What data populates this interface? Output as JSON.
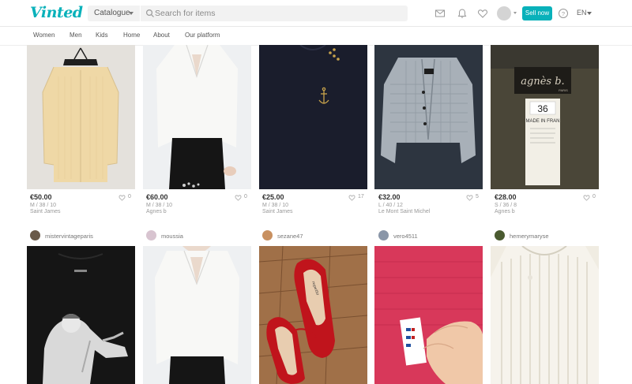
{
  "header": {
    "logo": "Vinted",
    "catalogue_label": "Catalogue",
    "search_placeholder": "Search for items",
    "sell_label": "Sell now",
    "language": "EN"
  },
  "nav": [
    "Women",
    "Men",
    "Kids",
    "Home",
    "About",
    "Our platform"
  ],
  "row1": [
    {
      "price": "€50.00",
      "size": "M / 38 / 10",
      "brand": "Saint James",
      "favs": "0"
    },
    {
      "price": "€60.00",
      "size": "M / 38 / 10",
      "brand": "Agnes b",
      "favs": "0"
    },
    {
      "price": "€25.00",
      "size": "M / 38 / 10",
      "brand": "Saint James",
      "favs": "17"
    },
    {
      "price": "€32.00",
      "size": "L / 40 / 12",
      "brand": "Le Mont Saint Michel",
      "favs": "5"
    },
    {
      "price": "€28.00",
      "size": "S / 36 / 8",
      "brand": "Agnes b",
      "favs": "0"
    }
  ],
  "users": [
    "mistervintageparis",
    "moussia",
    "sezane47",
    "vero4511",
    "hemerymaryse"
  ],
  "photo_text": {
    "agnes_label": "agnès b.",
    "agnes_paris": "PARIS",
    "agnes_size": "36",
    "agnes_made": "MADE IN FRAN",
    "repetto": "repetto"
  },
  "colors": {
    "accent": "#09b1ba"
  }
}
